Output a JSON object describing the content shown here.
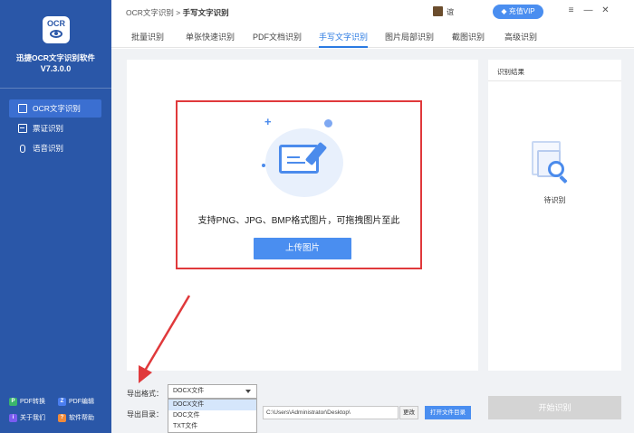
{
  "app": {
    "logo_text": "OCR",
    "name": "迅捷OCR文字识别软件",
    "version": "V7.3.0.0"
  },
  "sidebar": {
    "items": [
      {
        "label": "OCR文字识别",
        "icon": "scan-icon",
        "active": true
      },
      {
        "label": "票证识别",
        "icon": "ticket-icon",
        "active": false
      },
      {
        "label": "语音识别",
        "icon": "mic-icon",
        "active": false
      }
    ],
    "bottom": [
      {
        "label": "PDF转换",
        "badge": "P",
        "color": "#3bb56c"
      },
      {
        "label": "PDF编辑",
        "badge": "Z",
        "color": "#4a7ef0"
      },
      {
        "label": "关于我们",
        "badge": "i",
        "color": "#7a5cf0"
      },
      {
        "label": "软件帮助",
        "badge": "?",
        "color": "#f08a3a"
      }
    ]
  },
  "topbar": {
    "breadcrumb_root": "OCR文字识别",
    "breadcrumb_sep": " > ",
    "breadcrumb_current": "手写文字识别",
    "user_name": "谊",
    "vip_label": "充值VIP",
    "window_buttons": [
      "≡",
      "—",
      "✕"
    ]
  },
  "tabs": [
    {
      "label": "批量识别",
      "active": false
    },
    {
      "label": "单张快速识别",
      "active": false
    },
    {
      "label": "PDF文档识别",
      "active": false
    },
    {
      "label": "手写文字识别",
      "active": true
    },
    {
      "label": "图片局部识别",
      "active": false
    },
    {
      "label": "截图识别",
      "active": false
    },
    {
      "label": "高级识别",
      "active": false
    }
  ],
  "upload": {
    "hint": "支持PNG、JPG、BMP格式图片，可拖拽图片至此",
    "button": "上传图片"
  },
  "result": {
    "title": "识别结果",
    "status": "待识别"
  },
  "bottom": {
    "format_label": "导出格式：",
    "format_selected": "DOCX文件",
    "format_options": [
      "DOCX文件",
      "DOC文件",
      "TXT文件"
    ],
    "dir_label": "导出目录：",
    "dir_value": "C:\\Users\\Administrator\\Desktop\\",
    "change_label": "更改",
    "open_dir_label": "打开文件目录",
    "start_label": "开始识别"
  },
  "colors": {
    "sidebar": "#2a57a8",
    "accent": "#4a8ef0",
    "annotation": "#e0393b"
  }
}
